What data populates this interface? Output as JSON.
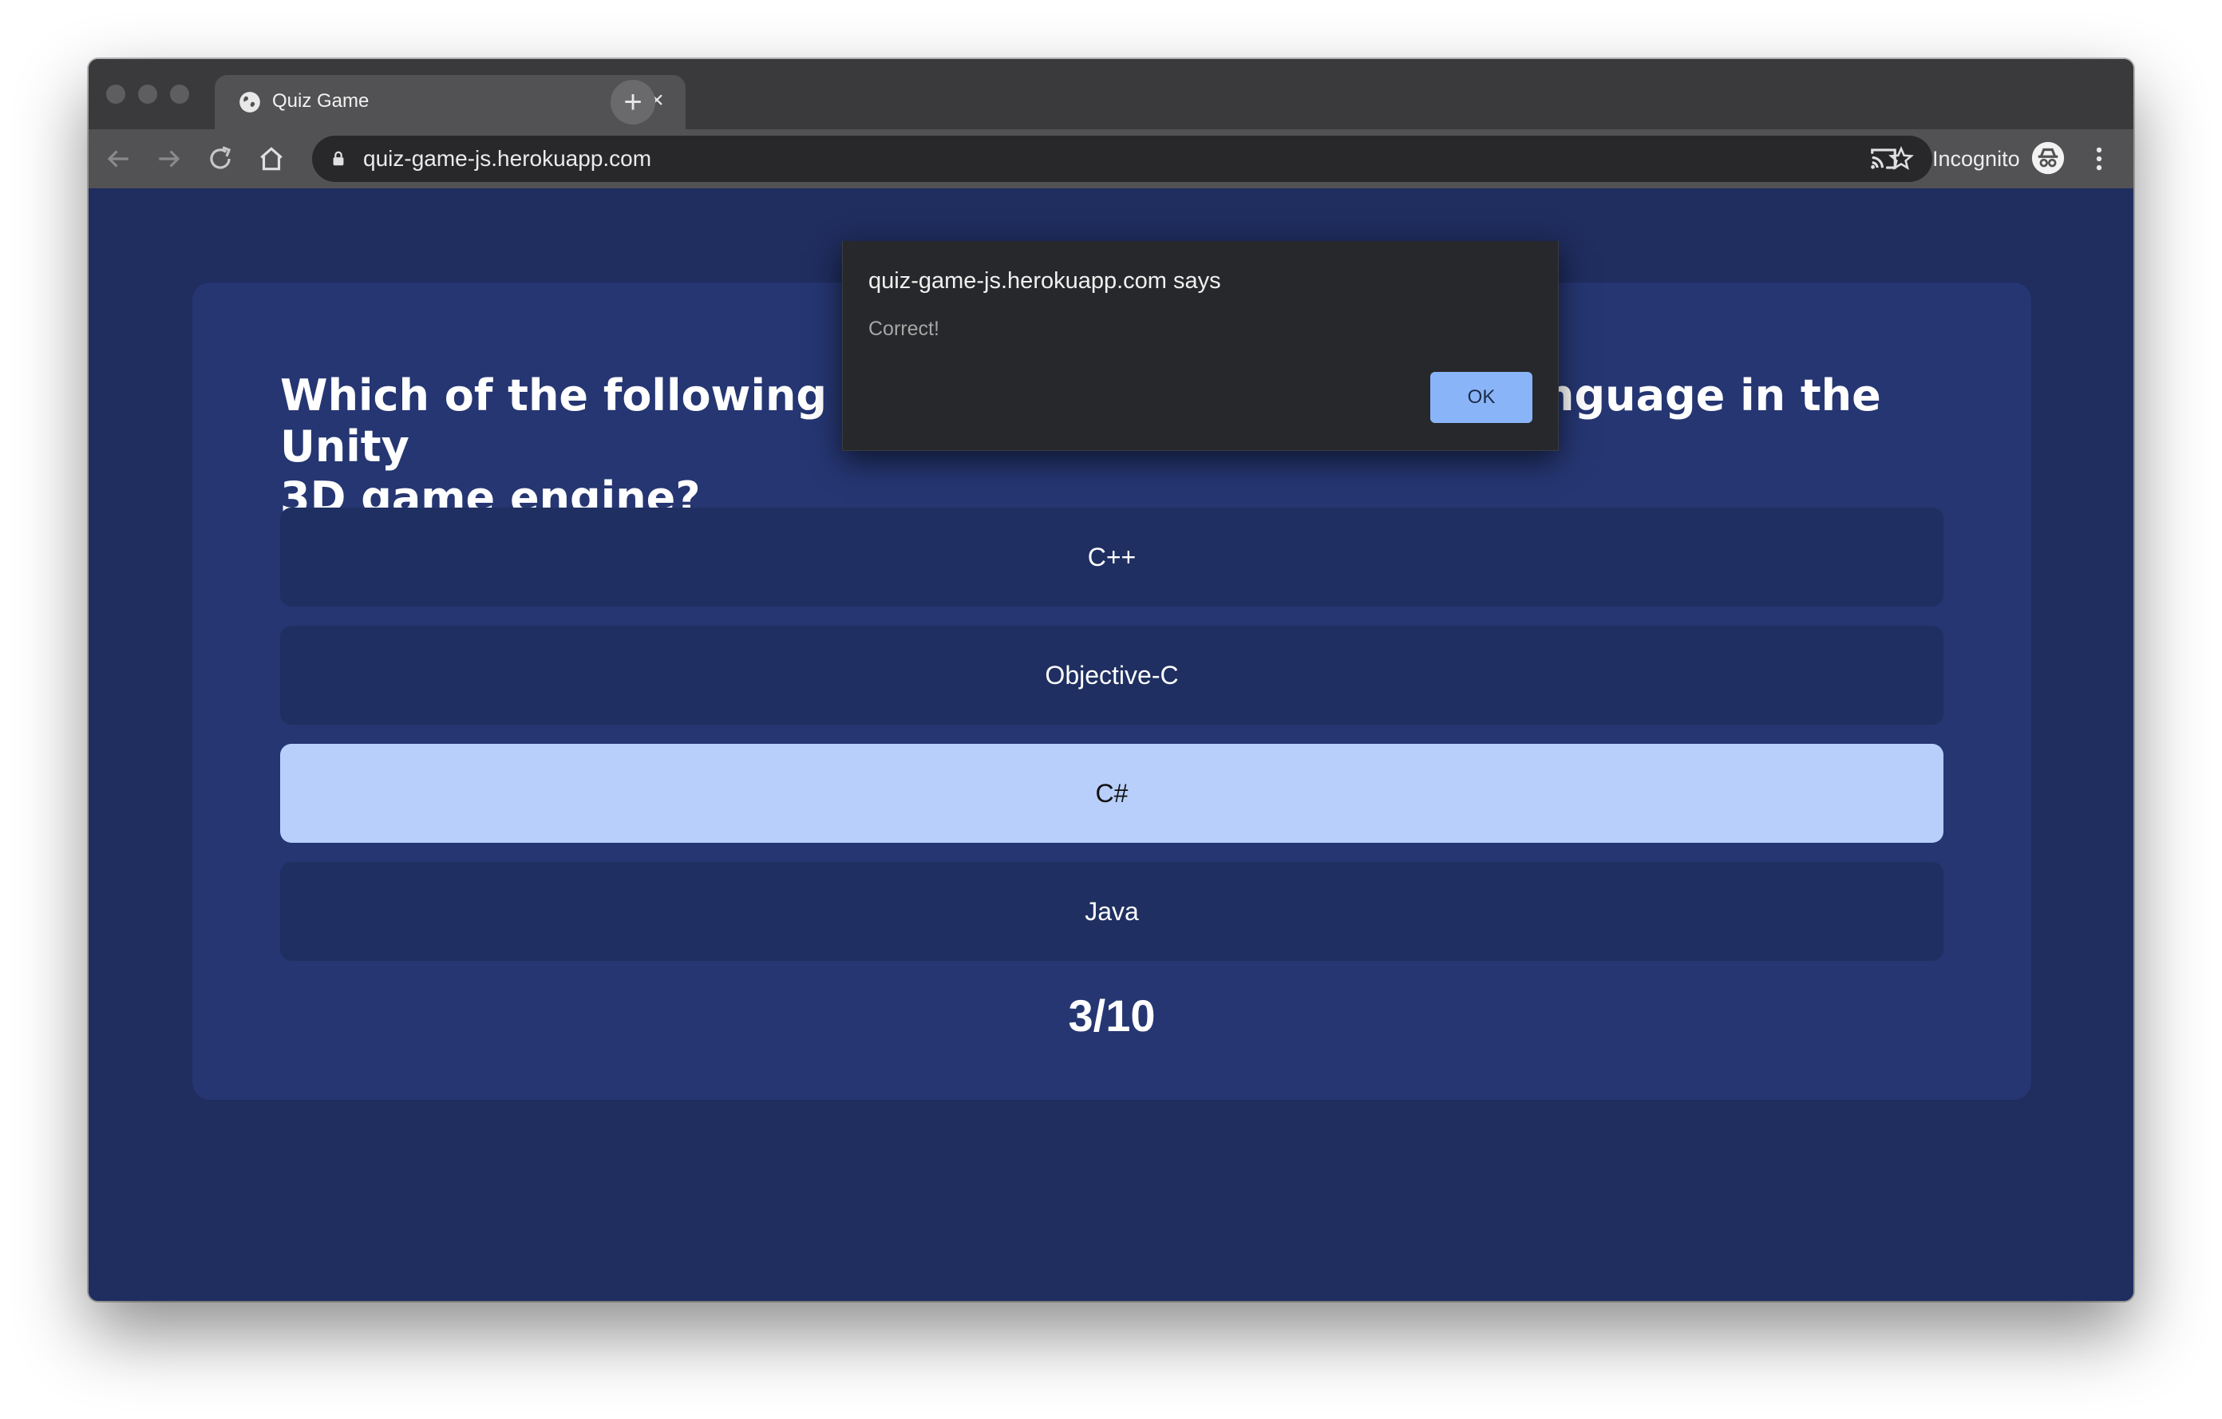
{
  "browser": {
    "tab": {
      "title": "Quiz Game",
      "favicon": "globe-icon",
      "close": "×"
    },
    "new_tab": "+",
    "toolbar": {
      "url": "quiz-game-js.herokuapp.com",
      "incognito_label": "Incognito"
    }
  },
  "quiz": {
    "question": "Which of the following language in the Unity 3D game engine?",
    "question_line1_left": "Which of the following",
    "question_line1_right": "nguage in the Unity",
    "question_line2": "3D game engine?",
    "answers": [
      {
        "label": "C++",
        "selected": false
      },
      {
        "label": "Objective-C",
        "selected": false
      },
      {
        "label": "C#",
        "selected": true
      },
      {
        "label": "Java",
        "selected": false
      }
    ],
    "score": "3/10"
  },
  "dialog": {
    "title": "quiz-game-js.herokuapp.com says",
    "message": "Correct!",
    "ok_label": "OK"
  },
  "colors": {
    "page_background": "#1f2d5f",
    "card_background": "#253672",
    "answer_background": "#1f2f61",
    "answer_selected": "#b8cffb",
    "dialog_background": "#27282b",
    "ok_button": "#8ab4f8"
  }
}
